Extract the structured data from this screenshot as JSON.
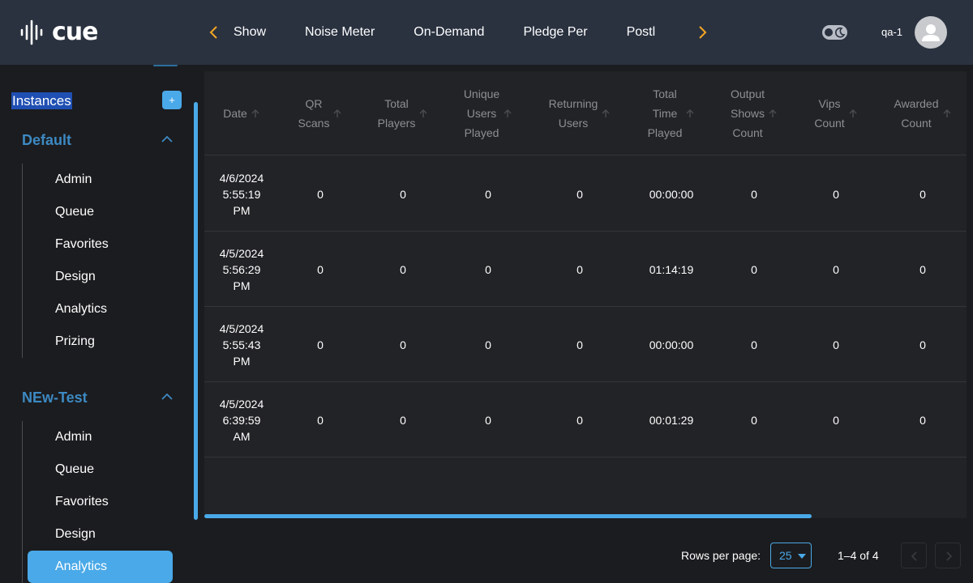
{
  "header": {
    "logo_text": "cue",
    "tabs": [
      "Show",
      "Noise Meter",
      "On-Demand",
      "Pledge Per",
      "Postl"
    ],
    "user_name": "qa-1",
    "accent_color": "#f5a623"
  },
  "sidebar": {
    "instances_label": "Instances",
    "add_label": "+",
    "groups": [
      {
        "title": "Default",
        "items": [
          "Admin",
          "Queue",
          "Favorites",
          "Design",
          "Analytics",
          "Prizing"
        ]
      },
      {
        "title": "NEw-Test",
        "items": [
          "Admin",
          "Queue",
          "Favorites",
          "Design",
          "Analytics"
        ],
        "active_item": "Analytics"
      }
    ]
  },
  "table": {
    "columns": [
      [
        "Date"
      ],
      [
        "QR",
        "Scans"
      ],
      [
        "Total",
        "Players"
      ],
      [
        "Unique",
        "Users",
        "Played"
      ],
      [
        "Returning",
        "Users"
      ],
      [
        "Total",
        "Time",
        "Played"
      ],
      [
        "Output",
        "Shows",
        "Count"
      ],
      [
        "Vips",
        "Count"
      ],
      [
        "Awarded",
        "Count"
      ]
    ],
    "rows": [
      {
        "date": [
          "4/6/2024",
          "5:55:19",
          "PM"
        ],
        "qr_scans": "0",
        "total_players": "0",
        "unique_users": "0",
        "returning_users": "0",
        "total_time": "00:00:00",
        "output_shows": "0",
        "vips": "0",
        "awarded": "0"
      },
      {
        "date": [
          "4/5/2024",
          "5:56:29",
          "PM"
        ],
        "qr_scans": "0",
        "total_players": "0",
        "unique_users": "0",
        "returning_users": "0",
        "total_time": "01:14:19",
        "output_shows": "0",
        "vips": "0",
        "awarded": "0"
      },
      {
        "date": [
          "4/5/2024",
          "5:55:43",
          "PM"
        ],
        "qr_scans": "0",
        "total_players": "0",
        "unique_users": "0",
        "returning_users": "0",
        "total_time": "00:00:00",
        "output_shows": "0",
        "vips": "0",
        "awarded": "0"
      },
      {
        "date": [
          "4/5/2024",
          "6:39:59",
          "AM"
        ],
        "qr_scans": "0",
        "total_players": "0",
        "unique_users": "0",
        "returning_users": "0",
        "total_time": "00:01:29",
        "output_shows": "0",
        "vips": "0",
        "awarded": "0"
      }
    ]
  },
  "pagination": {
    "rows_per_page_label": "Rows per page:",
    "rows_per_page": "25",
    "range": "1–4 of 4"
  },
  "colors": {
    "header_bg": "#2a3240",
    "primary": "#4aa9e8",
    "group_title": "#3d89c2"
  }
}
